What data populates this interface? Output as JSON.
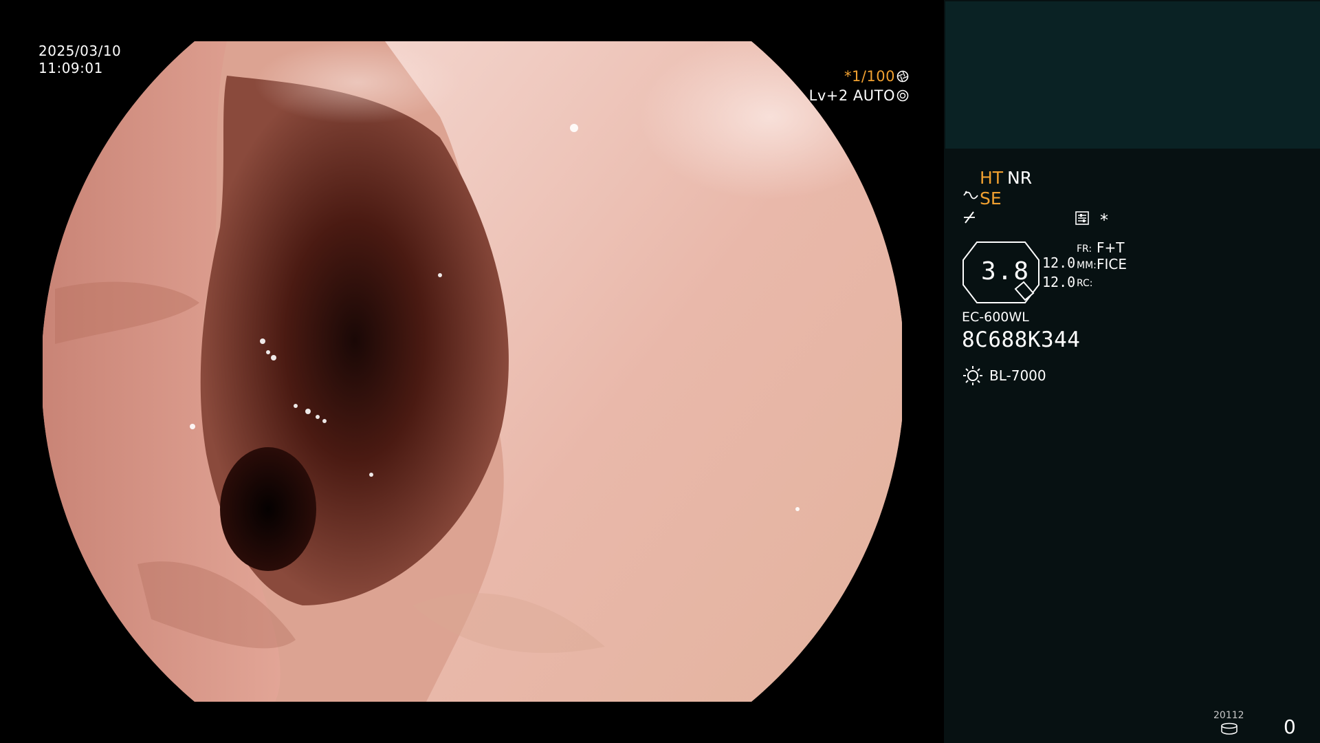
{
  "overlay": {
    "date": "2025/03/10",
    "time": "11:09:01",
    "shutter": "*1/100",
    "shutter_icon": "aperture-icon",
    "light_level": "Lv+2 AUTO",
    "light_icon": "iris-icon"
  },
  "panel": {
    "ht": "HT",
    "nr": "NR",
    "se_icon": "curve-icon",
    "se": "SE",
    "mod_icon": "slash-icon",
    "process_icon": "image-process-icon",
    "star": "*",
    "gauge_value": "3.8",
    "val1": "12.0",
    "val2": "12.0",
    "fr_label": "FR:",
    "fr_value": "F+T",
    "mm_label": "MM:",
    "mm_value": "FICE",
    "rc_label": "RC:",
    "scope_model": "EC-600WL",
    "serial": "8C688K344",
    "light_icon": "sun-icon",
    "light_model": "BL-7000",
    "footer_num": "20112",
    "footer_icon": "storage-icon",
    "footer_count": "0"
  },
  "colors": {
    "accent": "#f0a030",
    "panel_bg": "#071112",
    "preview_bg": "#0a2224"
  }
}
